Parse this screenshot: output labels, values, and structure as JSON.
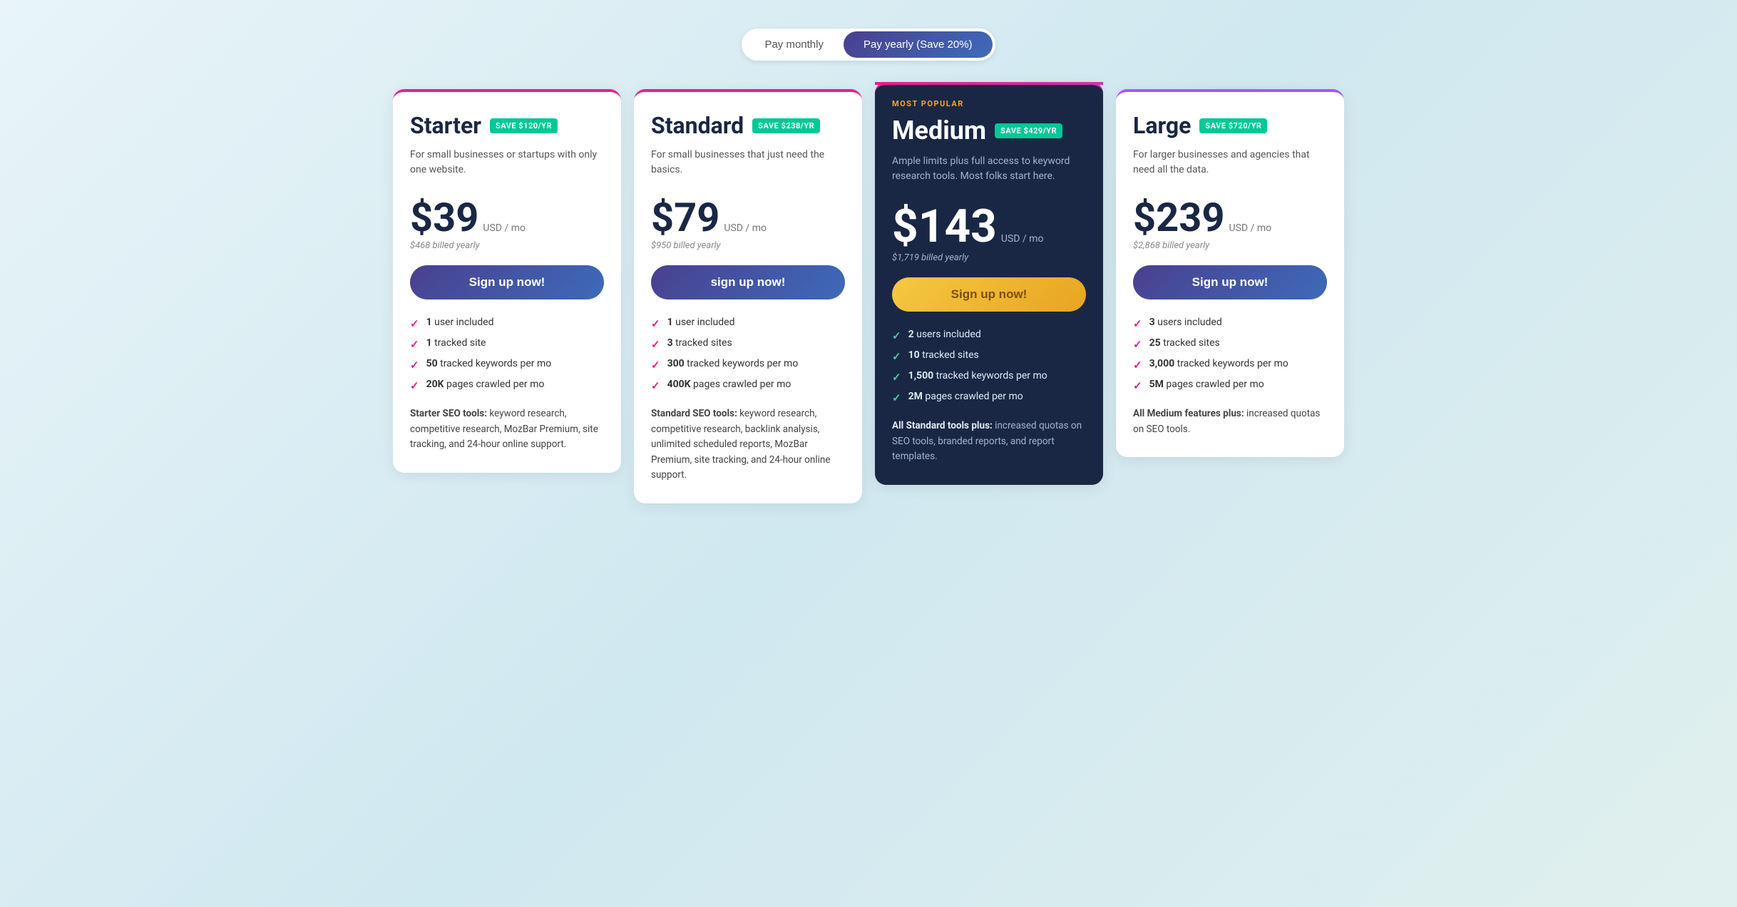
{
  "billing": {
    "toggle_monthly": "Pay monthly",
    "toggle_yearly": "Pay yearly (Save 20%)",
    "active": "yearly"
  },
  "plans": [
    {
      "id": "starter",
      "name": "Starter",
      "save_badge": "SAVE $120/YR",
      "description": "For small businesses or startups with only one website.",
      "price": "$39",
      "price_unit": "USD / mo",
      "billed": "$468 billed yearly",
      "cta": "Sign up now!",
      "cta_style": "dark",
      "features": [
        {
          "bold": "1",
          "text": " user included"
        },
        {
          "bold": "1",
          "text": " tracked site"
        },
        {
          "bold": "50",
          "text": " tracked keywords per mo"
        },
        {
          "bold": "20K",
          "text": " pages crawled per mo"
        }
      ],
      "tools_label": "Starter SEO tools:",
      "tools_text": " keyword research, competitive research, MozBar Premium, site tracking, and 24-hour online support."
    },
    {
      "id": "standard",
      "name": "Standard",
      "save_badge": "SAVE $238/YR",
      "description": "For small businesses that just need the basics.",
      "price": "$79",
      "price_unit": "USD / mo",
      "billed": "$950 billed yearly",
      "cta": "sign up now!",
      "cta_style": "dark",
      "features": [
        {
          "bold": "1",
          "text": " user included"
        },
        {
          "bold": "3",
          "text": " tracked sites"
        },
        {
          "bold": "300",
          "text": " tracked keywords per mo"
        },
        {
          "bold": "400K",
          "text": " pages crawled per mo"
        }
      ],
      "tools_label": "Standard SEO tools:",
      "tools_text": " keyword research, competitive research, backlink analysis, unlimited scheduled reports, MozBar Premium, site tracking, and 24-hour online support."
    },
    {
      "id": "medium",
      "name": "Medium",
      "most_popular": "MOST POPULAR",
      "save_badge": "SAVE $429/YR",
      "description": "Ample limits plus full access to keyword research tools. Most folks start here.",
      "price": "$143",
      "price_unit": "USD / mo",
      "billed": "$1,719 billed yearly",
      "cta": "Sign up now!",
      "cta_style": "gold",
      "features": [
        {
          "bold": "2",
          "text": " users included"
        },
        {
          "bold": "10",
          "text": " tracked sites"
        },
        {
          "bold": "1,500",
          "text": " tracked keywords per mo"
        },
        {
          "bold": "2M",
          "text": " pages crawled per mo"
        }
      ],
      "tools_label": "All Standard tools plus:",
      "tools_text": " increased quotas on SEO tools, branded reports, and report templates."
    },
    {
      "id": "large",
      "name": "Large",
      "save_badge": "SAVE $720/YR",
      "description": "For larger businesses and agencies that need all the data.",
      "price": "$239",
      "price_unit": "USD / mo",
      "billed": "$2,868 billed yearly",
      "cta": "Sign up now!",
      "cta_style": "dark",
      "features": [
        {
          "bold": "3",
          "text": " users included"
        },
        {
          "bold": "25",
          "text": " tracked sites"
        },
        {
          "bold": "3,000",
          "text": " tracked keywords per mo"
        },
        {
          "bold": "5M",
          "text": " pages crawled per mo"
        }
      ],
      "tools_label": "All Medium features plus:",
      "tools_text": " increased quotas on SEO tools."
    }
  ]
}
